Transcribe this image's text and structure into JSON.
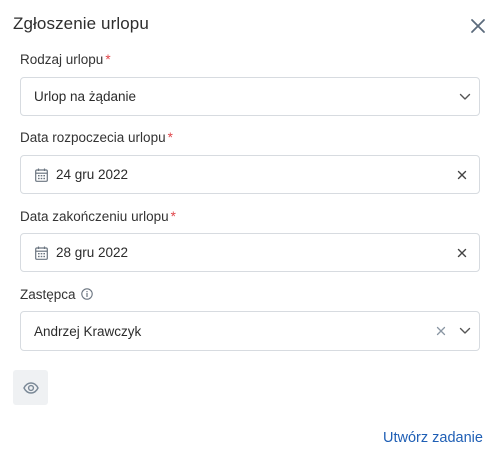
{
  "dialog": {
    "title": "Zgłoszenie urlopu",
    "close_icon": "close-icon"
  },
  "leave_type": {
    "label": "Rodzaj urlopu",
    "required_mark": "*",
    "value": "Urlop na żądanie"
  },
  "start_date": {
    "label": "Data rozpoczecia urlopu",
    "required_mark": "*",
    "value": "24 gru 2022"
  },
  "end_date": {
    "label": "Data zakończeniu urlopu",
    "required_mark": "*",
    "value": "28 gru 2022"
  },
  "substitute": {
    "label": "Zastępca",
    "value": "Andrzej Krawczyk",
    "info_icon": "info-icon"
  },
  "actions": {
    "preview_icon": "eye-icon",
    "create_label": "Utwórz zadanie"
  },
  "colors": {
    "accent": "#1f5fb5",
    "required": "#e0454a",
    "border": "#d7dbe0"
  }
}
